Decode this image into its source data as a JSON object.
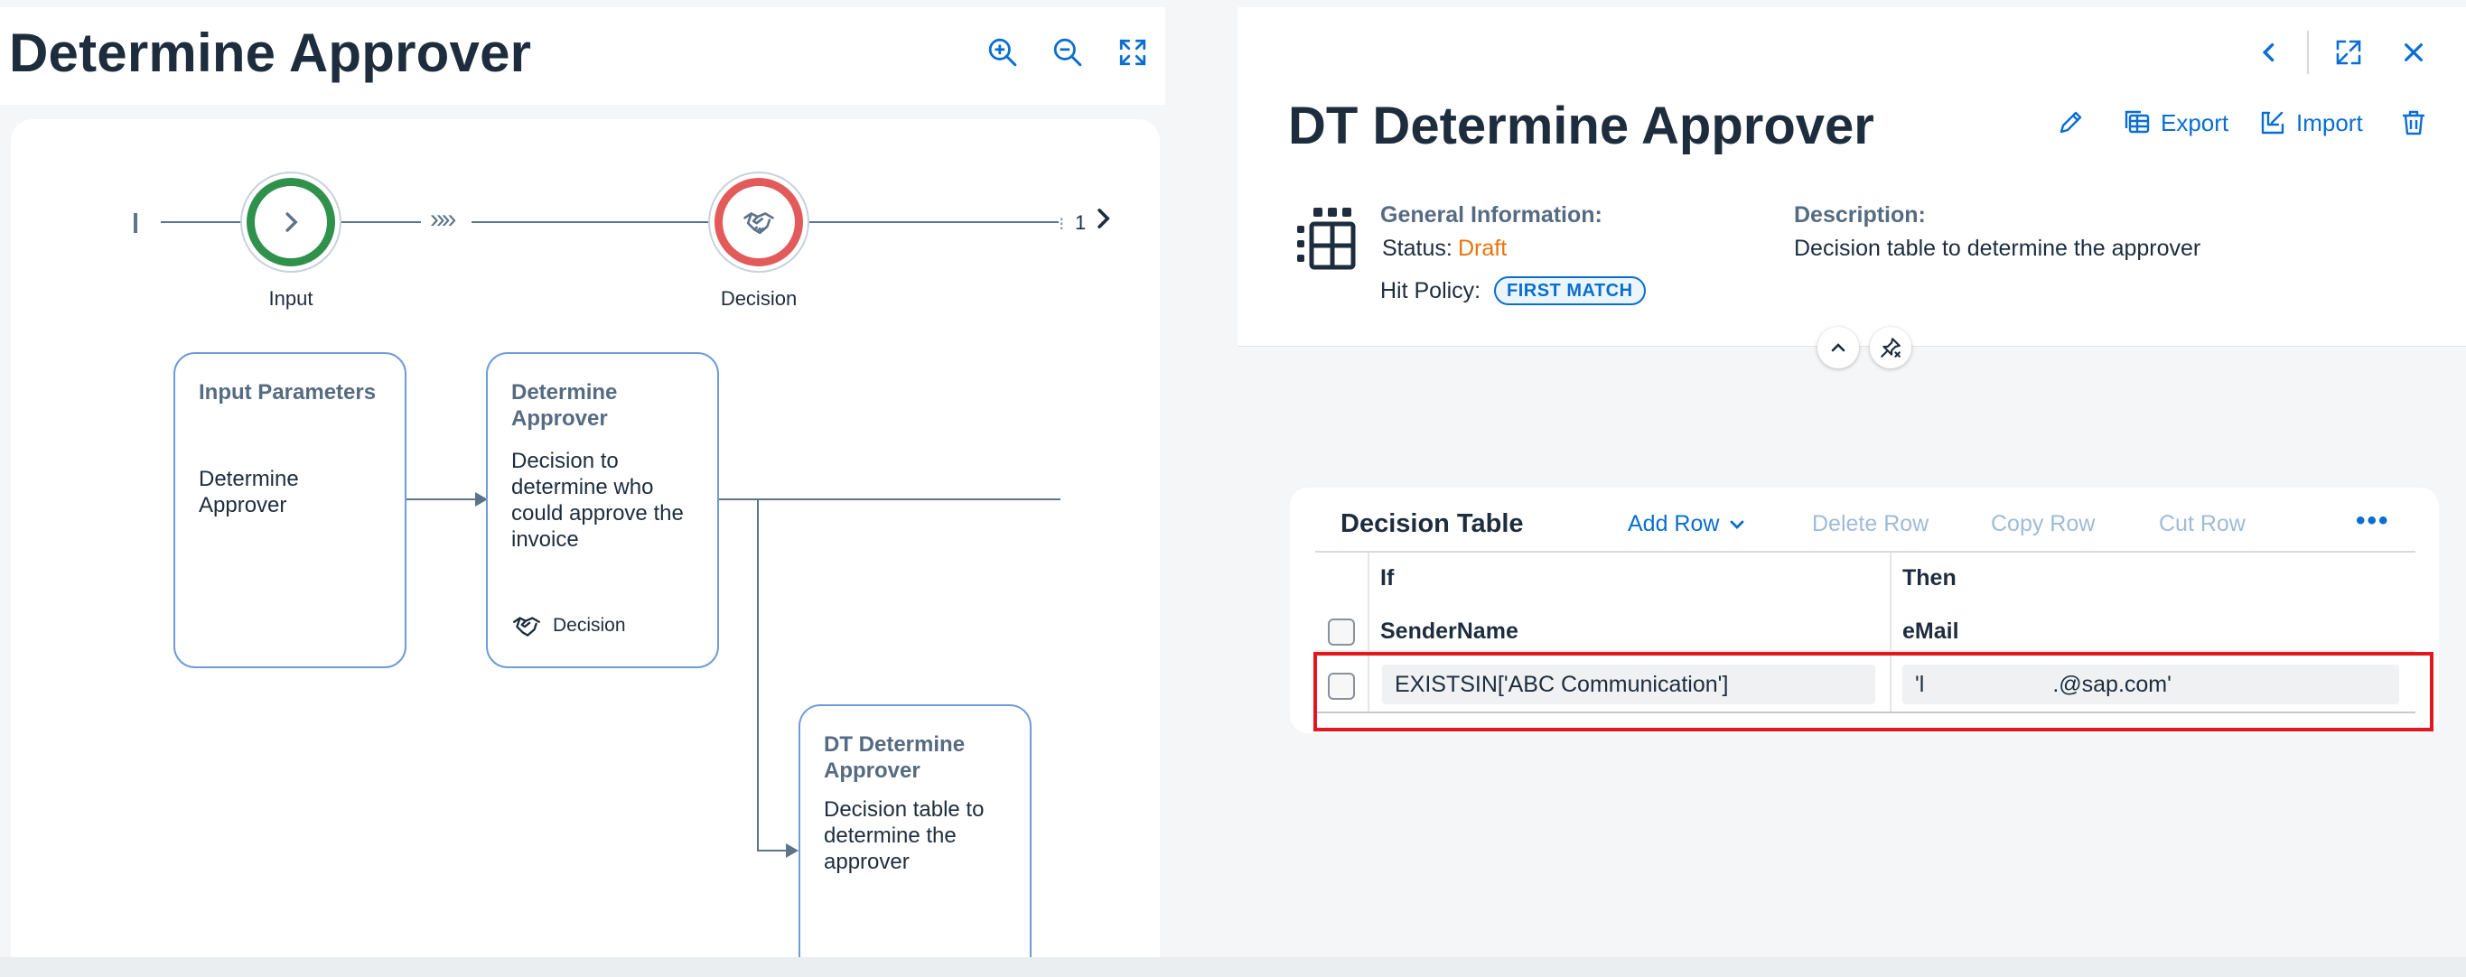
{
  "left_pane": {
    "title": "Determine Approver",
    "toolbar": {
      "zoom_in": "zoom-in-icon",
      "zoom_out": "zoom-out-icon",
      "fit": "fit-screen-icon"
    },
    "steps": [
      {
        "label": "Input",
        "color": "#30914c",
        "icon": "chevron-right-icon"
      },
      {
        "label": "Decision",
        "color": "#e35a5a",
        "icon": "handshake-icon"
      }
    ],
    "pager": {
      "value": "1"
    },
    "nodes": [
      {
        "title": "Input Parameters",
        "description": "Determine Approver"
      },
      {
        "title": "Determine Approver",
        "description": "Decision to determine who could approve the invoice",
        "type_label": "Decision"
      },
      {
        "title": "DT Determine Approver",
        "description": "Decision table to determine the approver"
      }
    ]
  },
  "right_pane": {
    "title": "DT Determine Approver",
    "actions": {
      "export": "Export",
      "import": "Import"
    },
    "general_info": {
      "heading": "General Information:",
      "status_label": "Status:",
      "status_value": "Draft",
      "hit_policy_label": "Hit Policy:",
      "hit_policy_value": "FIRST MATCH"
    },
    "description": {
      "heading": "Description:",
      "text": "Decision table to determine the approver"
    },
    "decision_table": {
      "title": "Decision Table",
      "toolbar": {
        "add_row": "Add Row",
        "delete_row": "Delete Row",
        "copy_row": "Copy Row",
        "cut_row": "Cut Row"
      },
      "groups": {
        "if": "If",
        "then": "Then"
      },
      "columns": {
        "condition": "SenderName",
        "result": "eMail"
      },
      "rows": [
        {
          "condition": "EXISTSIN['ABC Communication']",
          "result_prefix": "'l",
          "result_suffix": ".@sap.com'"
        }
      ]
    }
  },
  "colors": {
    "accent": "#0a6ed1",
    "highlight": "#e3171f",
    "status_draft": "#e9730c"
  }
}
